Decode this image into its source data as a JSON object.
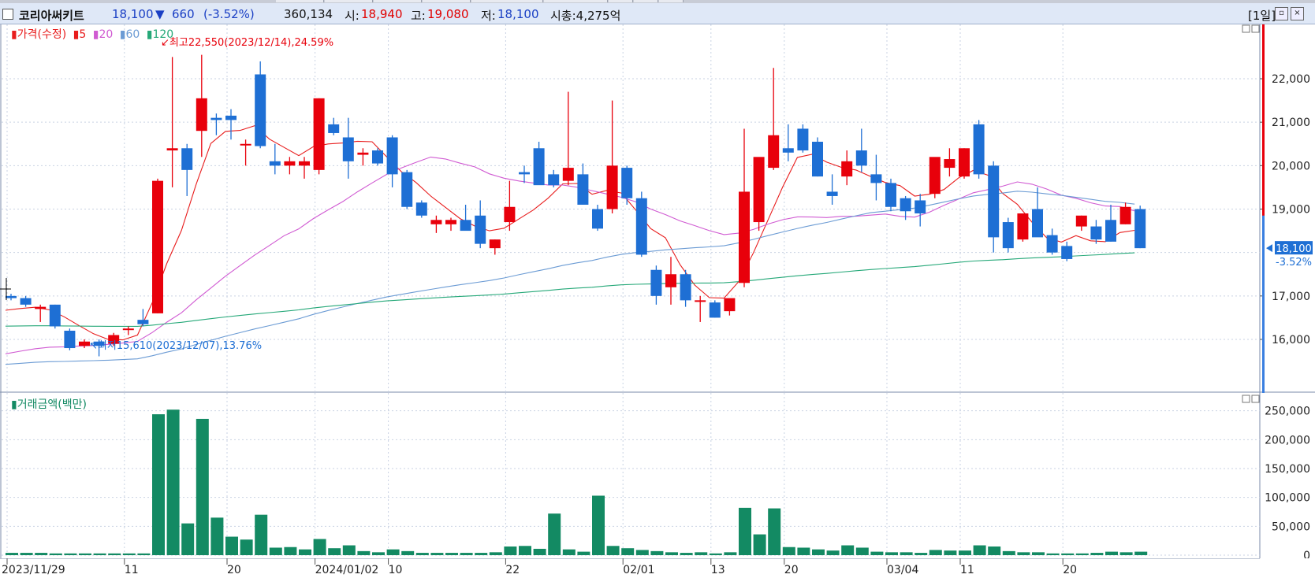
{
  "header": {
    "name": "코리아써키트",
    "price": "18,100",
    "change_arrow": "▼",
    "change": "660",
    "change_pct": "(-3.52%)",
    "volume": "360,134",
    "open_label": "시:",
    "open": "18,940",
    "high_label": "고:",
    "high": "19,080",
    "low_label": "저:",
    "low": "18,100",
    "mcap": "시총:4,275억",
    "period": "[1일]"
  },
  "price_panel": {
    "legend_title": "가격(수정)",
    "ma_labels": [
      "5",
      "20",
      "60",
      "120"
    ],
    "high_note": "최고22,550(2023/12/14),24.59%",
    "low_note": "최저15,610(2023/12/07),13.76%",
    "y_ticks": [
      "22,000",
      "21,000",
      "20,000",
      "19,000",
      "17,000",
      "16,000"
    ],
    "current_price": "18,100",
    "current_pct": "-3.52%"
  },
  "volume_panel": {
    "legend_title": "거래금액(백만)",
    "y_ticks": [
      "250,000",
      "200,000",
      "150,000",
      "100,000",
      "50,000",
      "0"
    ]
  },
  "x_axis": {
    "labels": [
      "2023/11/29",
      "11",
      "20",
      "2024/01/02",
      "10",
      "22",
      "02/01",
      "13",
      "20",
      "03/04",
      "11",
      "20"
    ]
  },
  "colors": {
    "up": "#e8000b",
    "down": "#1e6fd4",
    "ma5": "#e81c1c",
    "ma20": "#d05ad2",
    "ma60": "#6b9bd4",
    "ma120": "#25a878",
    "volume": "#138a63"
  },
  "chart_data": [
    {
      "type": "candlestick",
      "title": "가격(수정)",
      "ylim": [
        15000,
        23500
      ],
      "ohlc": [
        [
          17000,
          17050,
          16900,
          16950
        ],
        [
          16950,
          17000,
          16750,
          16800
        ],
        [
          16700,
          16800,
          16400,
          16750
        ],
        [
          16800,
          16800,
          16250,
          16300
        ],
        [
          16200,
          16250,
          15750,
          15800
        ],
        [
          15850,
          16000,
          15800,
          15950
        ],
        [
          15950,
          16000,
          15610,
          15850
        ],
        [
          15900,
          16150,
          15850,
          16100
        ],
        [
          16250,
          16300,
          16100,
          16250
        ],
        [
          16450,
          16700,
          16300,
          16350
        ],
        [
          16600,
          19700,
          16600,
          19650
        ],
        [
          20350,
          22500,
          19500,
          20400
        ],
        [
          20400,
          20500,
          19300,
          19900
        ],
        [
          20800,
          22550,
          20200,
          21550
        ],
        [
          21100,
          21200,
          20700,
          21050
        ],
        [
          21150,
          21300,
          20600,
          21050
        ],
        [
          20500,
          20600,
          20000,
          20500
        ],
        [
          22100,
          22400,
          20400,
          20450
        ],
        [
          20100,
          20500,
          19800,
          20000
        ],
        [
          20000,
          20200,
          19800,
          20100
        ],
        [
          20000,
          20200,
          19700,
          20100
        ],
        [
          19900,
          21550,
          19800,
          21550
        ],
        [
          20950,
          21100,
          20700,
          20750
        ],
        [
          20650,
          21100,
          19700,
          20100
        ],
        [
          20250,
          20400,
          20000,
          20300
        ],
        [
          20350,
          20400,
          20000,
          20050
        ],
        [
          20650,
          20700,
          19500,
          19800
        ],
        [
          19850,
          19900,
          19000,
          19050
        ],
        [
          19150,
          19200,
          18800,
          18850
        ],
        [
          18650,
          18850,
          18450,
          18750
        ],
        [
          18650,
          18800,
          18500,
          18750
        ],
        [
          18750,
          19100,
          18600,
          18500
        ],
        [
          18850,
          19200,
          18100,
          18200
        ],
        [
          18100,
          18300,
          17950,
          18300
        ],
        [
          18700,
          19650,
          18500,
          19050
        ],
        [
          19850,
          20000,
          19600,
          19800
        ],
        [
          20400,
          20550,
          19600,
          19550
        ],
        [
          19800,
          19900,
          19500,
          19550
        ],
        [
          19650,
          21700,
          19550,
          19950
        ],
        [
          19800,
          20050,
          19100,
          19100
        ],
        [
          19000,
          19100,
          18500,
          18550
        ],
        [
          19000,
          21500,
          18900,
          20000
        ],
        [
          19950,
          20000,
          19100,
          19250
        ],
        [
          19250,
          19400,
          17900,
          17950
        ],
        [
          17600,
          17700,
          16800,
          17000
        ],
        [
          17200,
          17900,
          16800,
          17500
        ],
        [
          17500,
          17600,
          16750,
          16900
        ],
        [
          16900,
          17000,
          16400,
          16900
        ],
        [
          16850,
          16900,
          16500,
          16500
        ],
        [
          16650,
          16900,
          16550,
          16950
        ],
        [
          17300,
          20850,
          17200,
          19400
        ],
        [
          18700,
          20000,
          18500,
          20200
        ],
        [
          19950,
          22250,
          19900,
          20700
        ],
        [
          20400,
          20950,
          20100,
          20300
        ],
        [
          20850,
          20950,
          20300,
          20350
        ],
        [
          20550,
          20650,
          19750,
          19750
        ],
        [
          19400,
          19800,
          19100,
          19300
        ],
        [
          19750,
          20350,
          19550,
          20100
        ],
        [
          20350,
          20850,
          19850,
          20000
        ],
        [
          19800,
          20250,
          19200,
          19600
        ],
        [
          19600,
          19700,
          18950,
          19050
        ],
        [
          19250,
          19300,
          18750,
          18950
        ],
        [
          19200,
          19350,
          18600,
          18900
        ],
        [
          19350,
          20150,
          19250,
          20200
        ],
        [
          19950,
          20400,
          19750,
          20150
        ],
        [
          19750,
          20400,
          19700,
          20400
        ],
        [
          20950,
          21050,
          19700,
          19800
        ],
        [
          20000,
          20100,
          18000,
          18350
        ],
        [
          18700,
          18800,
          18000,
          18100
        ],
        [
          18300,
          18900,
          18250,
          18900
        ],
        [
          19000,
          19500,
          18450,
          18350
        ],
        [
          18400,
          18550,
          17950,
          18000
        ],
        [
          18150,
          18250,
          17800,
          17850
        ],
        [
          18600,
          18850,
          18500,
          18850
        ],
        [
          18600,
          18750,
          18200,
          18300
        ],
        [
          18750,
          19100,
          18250,
          18250
        ],
        [
          18650,
          19150,
          18650,
          19050
        ],
        [
          19000,
          19080,
          18100,
          18100
        ]
      ]
    },
    {
      "type": "bar",
      "title": "거래금액(백만)",
      "ylim": [
        0,
        270000
      ],
      "values": [
        4000,
        4000,
        4000,
        3000,
        3000,
        3000,
        3000,
        3000,
        3000,
        3000,
        244000,
        252000,
        55000,
        236000,
        65000,
        32000,
        27000,
        70000,
        13000,
        14000,
        10000,
        28000,
        12000,
        17000,
        7000,
        5000,
        10000,
        7000,
        4000,
        4000,
        4000,
        4000,
        4000,
        5000,
        15000,
        16000,
        11000,
        72000,
        10000,
        6000,
        103000,
        16000,
        12000,
        9000,
        7000,
        5000,
        4000,
        5000,
        3000,
        5000,
        82000,
        36000,
        81000,
        14000,
        13000,
        10000,
        8000,
        17000,
        13000,
        6000,
        5000,
        5000,
        4000,
        9000,
        8000,
        8000,
        17000,
        15000,
        7000,
        5000,
        5000,
        3000,
        3000,
        3000,
        4000,
        6000,
        5000,
        6000
      ]
    }
  ]
}
